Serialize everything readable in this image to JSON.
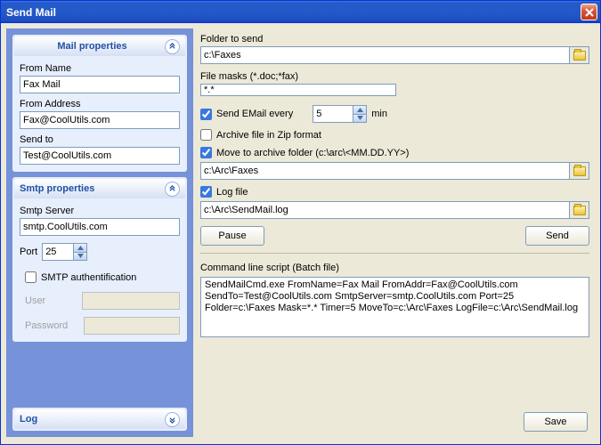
{
  "window": {
    "title": "Send Mail"
  },
  "sidebar": {
    "mail": {
      "header": "Mail properties",
      "from_name_label": "From Name",
      "from_name": "Fax Mail",
      "from_addr_label": "From Address",
      "from_addr": "Fax@CoolUtils.com",
      "send_to_label": "Send to",
      "send_to": "Test@CoolUtils.com"
    },
    "smtp": {
      "header": "Smtp properties",
      "server_label": "Smtp Server",
      "server": "smtp.CoolUtils.com",
      "port_label": "Port",
      "port": "25",
      "auth_label": "SMTP authentification",
      "auth_checked": false,
      "user_label": "User",
      "password_label": "Password"
    },
    "log": {
      "header": "Log"
    }
  },
  "main": {
    "folder_label": "Folder to send",
    "folder": "c:\\Faxes",
    "masks_label": "File masks (*.doc;*fax)",
    "masks": "*.*",
    "send_every_checked": true,
    "send_every_label": "Send EMail every",
    "send_every_value": "5",
    "send_every_unit": "min",
    "archive_zip_checked": false,
    "archive_zip_label": "Archive file in Zip format",
    "move_archive_checked": true,
    "move_archive_label": "Move to archive folder (c:\\arc\\<MM.DD.YY>)",
    "archive_folder": "c:\\Arc\\Faxes",
    "logfile_checked": true,
    "logfile_label": "Log file",
    "logfile": "c:\\Arc\\SendMail.log",
    "pause_btn": "Pause",
    "send_btn": "Send",
    "cmd_label": "Command line script (Batch file)",
    "cmd_text": "SendMailCmd.exe  FromName=Fax Mail FromAddr=Fax@CoolUtils.com SendTo=Test@CoolUtils.com SmtpServer=smtp.CoolUtils.com Port=25 Folder=c:\\Faxes Mask=*.* Timer=5 MoveTo=c:\\Arc\\Faxes LogFile=c:\\Arc\\SendMail.log",
    "save_btn": "Save"
  }
}
